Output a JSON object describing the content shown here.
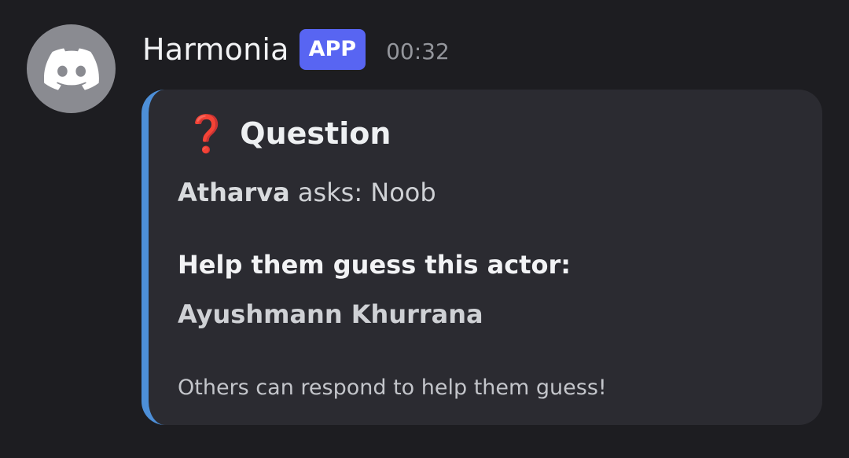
{
  "message": {
    "author": {
      "name": "Harmonia",
      "badge": "APP",
      "avatar_icon": "discord-logo-icon",
      "avatar_color": "#8a8b91",
      "badge_color": "#5865f2"
    },
    "timestamp": "00:32",
    "embed": {
      "accent_color": "#4d8fd8",
      "title_icon": "question-mark-icon",
      "title_icon_glyph": "❓",
      "title": "Question",
      "asker": "Atharva",
      "ask_suffix": "asks: Noob",
      "field_name": "Help them guess this actor:",
      "field_value": "Ayushmann Khurrana",
      "footer": "Others can respond to help them guess!"
    }
  }
}
